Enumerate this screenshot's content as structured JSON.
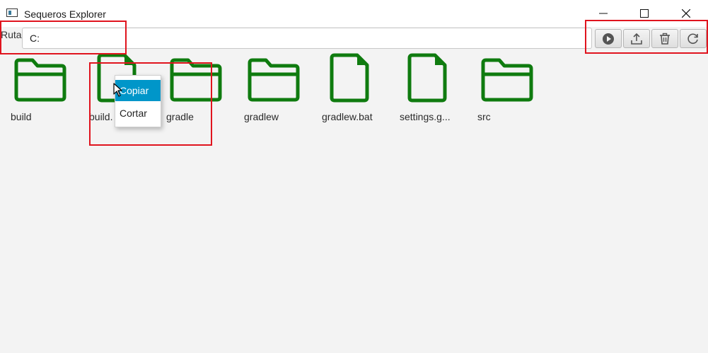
{
  "window": {
    "title": "Sequeros Explorer",
    "controls": [
      "minimize-icon",
      "maximize-icon",
      "close-icon"
    ]
  },
  "toolbar": {
    "path_label": "Ruta",
    "path_value": "C:",
    "buttons": [
      {
        "name": "run-button",
        "icon": "play-circle-icon"
      },
      {
        "name": "upload-button",
        "icon": "upload-icon"
      },
      {
        "name": "delete-button",
        "icon": "trash-icon"
      },
      {
        "name": "refresh-button",
        "icon": "refresh-icon"
      }
    ]
  },
  "files": [
    {
      "label": "build",
      "type": "folder"
    },
    {
      "label": "build.",
      "type": "file"
    },
    {
      "label": "gradle",
      "type": "folder"
    },
    {
      "label": "gradlew",
      "type": "folder"
    },
    {
      "label": "gradlew.bat",
      "type": "file"
    },
    {
      "label": "settings.g...",
      "type": "file"
    },
    {
      "label": "src",
      "type": "folder"
    }
  ],
  "context_menu": {
    "items": [
      {
        "label": "Copiar",
        "highlighted": true
      },
      {
        "label": "Cortar",
        "highlighted": false
      }
    ]
  },
  "colors": {
    "icon_green": "#0f7b0f",
    "menu_highlight": "#0096c9",
    "annotation_red": "#e0141e"
  }
}
